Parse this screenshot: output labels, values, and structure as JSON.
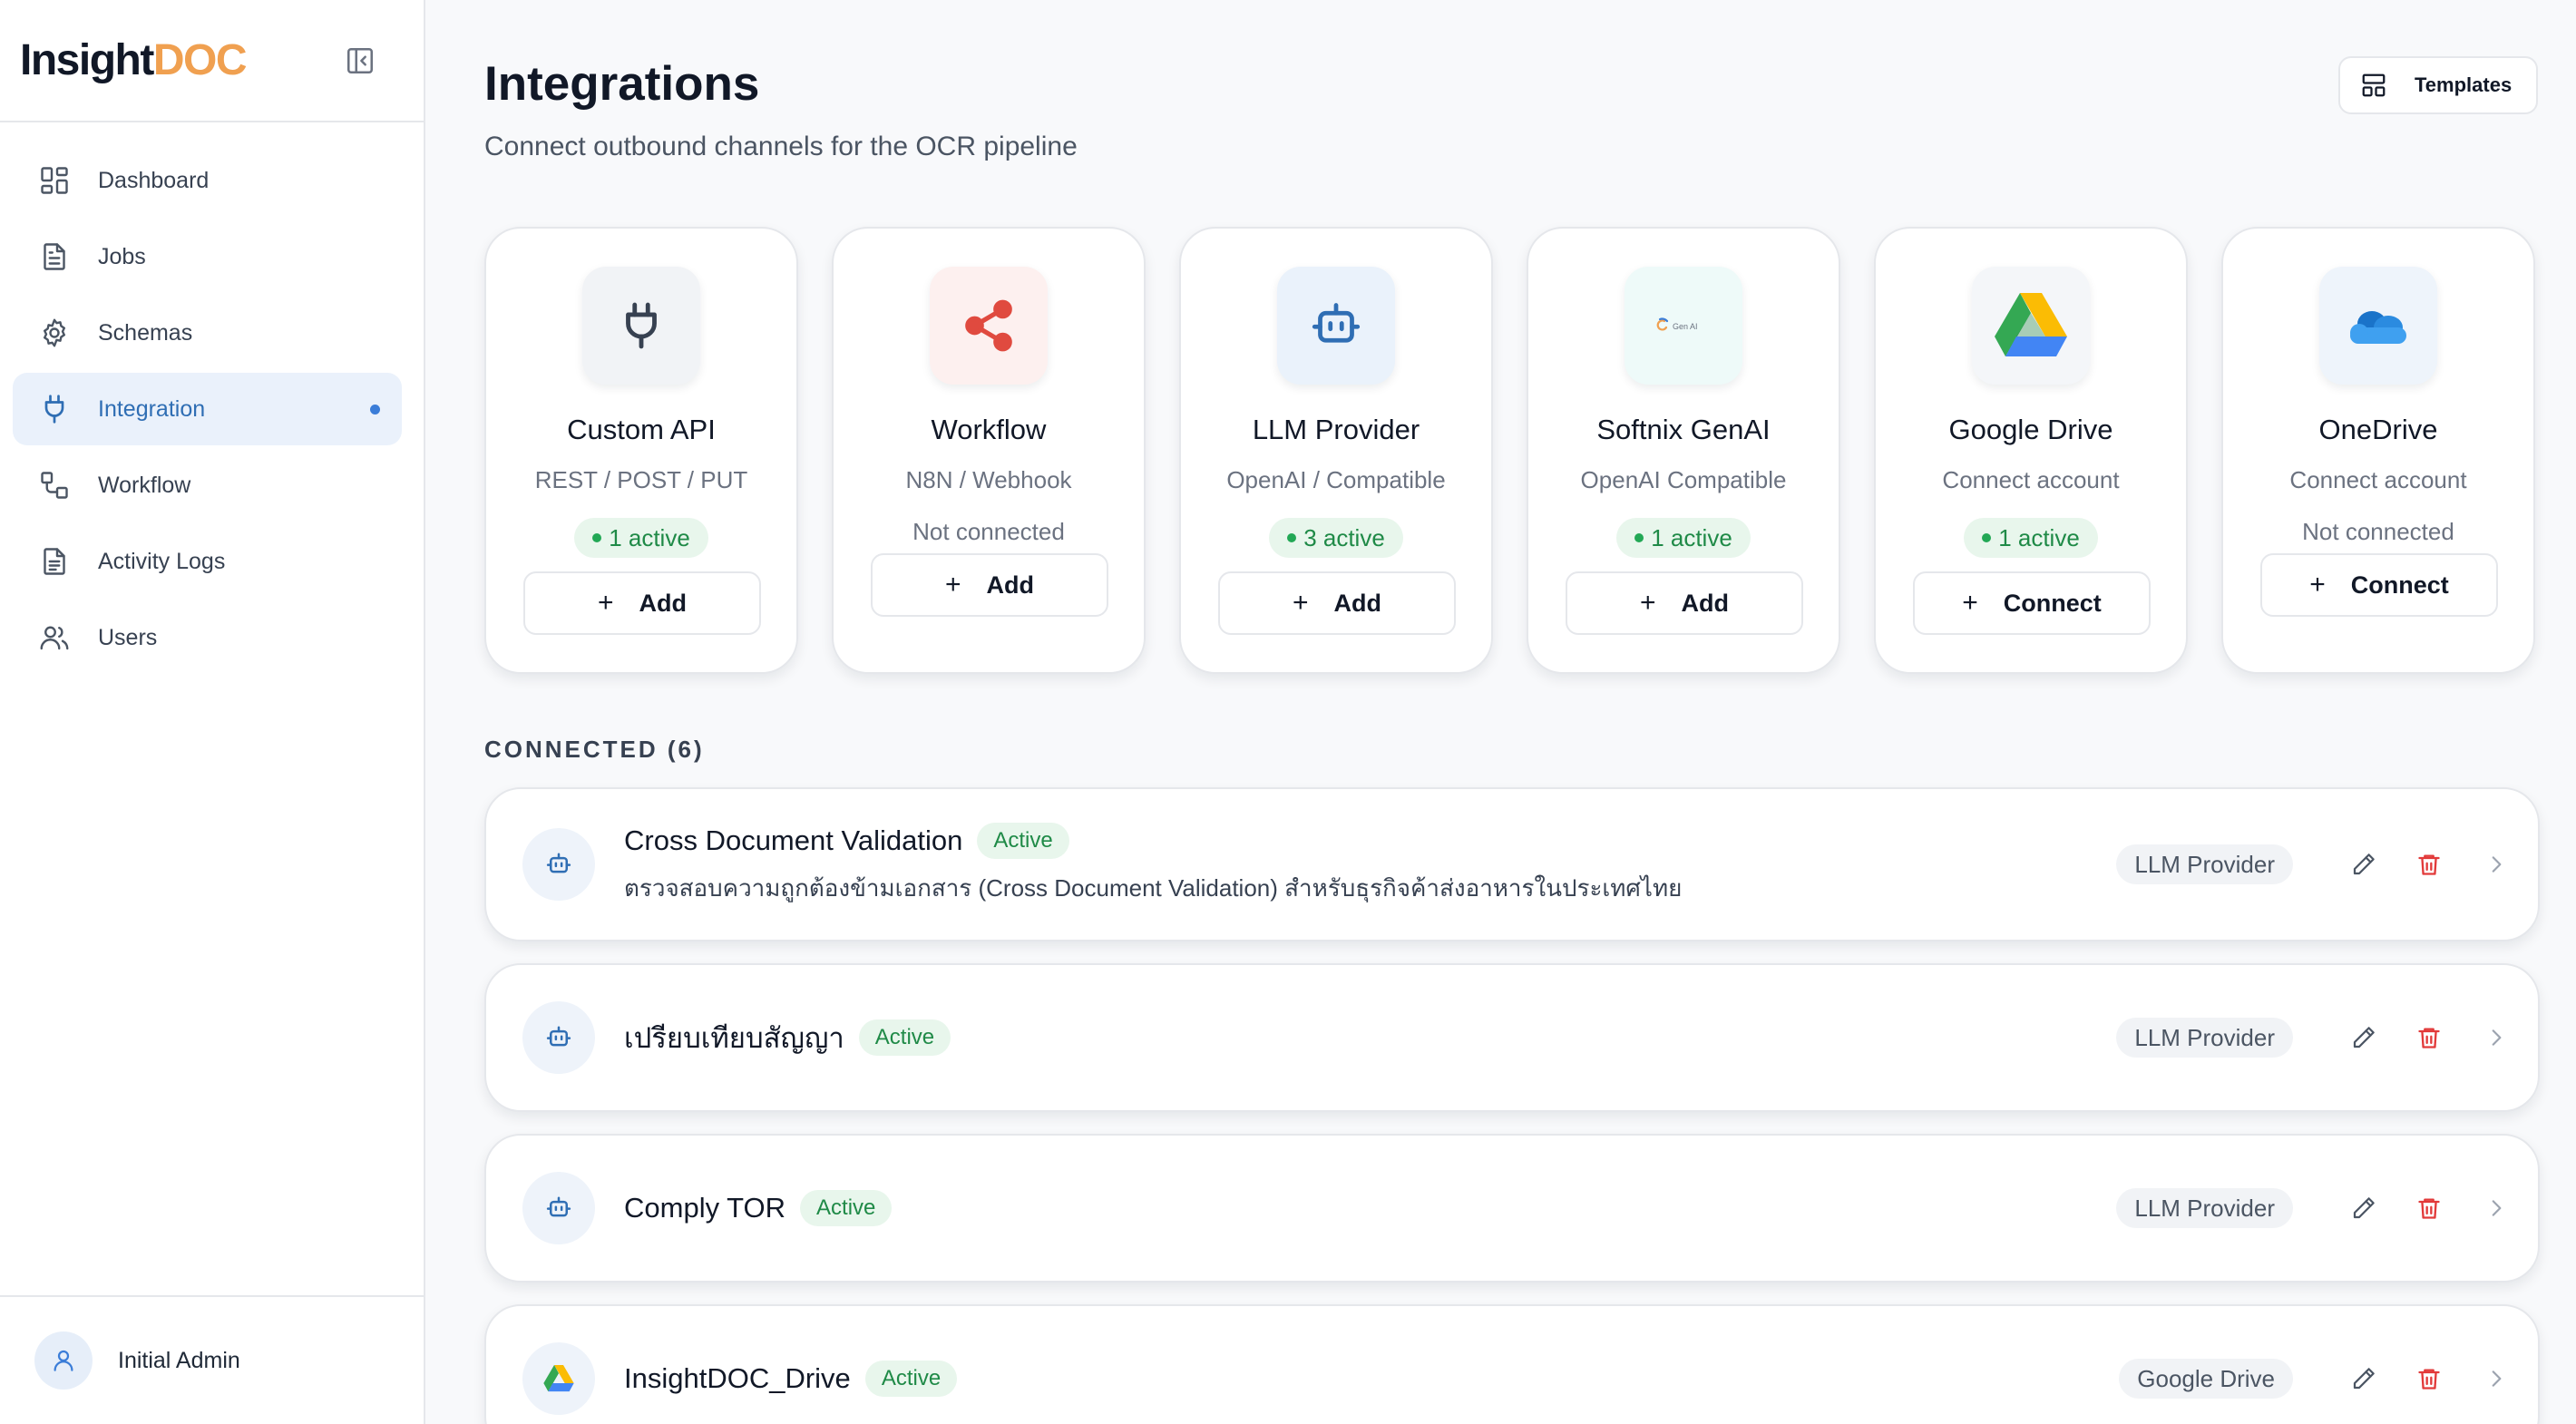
{
  "brand": {
    "logo_part1": "Insight",
    "logo_part2": "DOC"
  },
  "sidebar": {
    "items": [
      {
        "label": "Dashboard",
        "icon": "dashboard-icon"
      },
      {
        "label": "Jobs",
        "icon": "document-icon"
      },
      {
        "label": "Schemas",
        "icon": "gear-icon"
      },
      {
        "label": "Integration",
        "icon": "plug-icon",
        "active": true
      },
      {
        "label": "Workflow",
        "icon": "workflow-icon"
      },
      {
        "label": "Activity Logs",
        "icon": "log-icon"
      },
      {
        "label": "Users",
        "icon": "users-icon"
      }
    ],
    "user": {
      "name": "Initial Admin"
    }
  },
  "header": {
    "title": "Integrations",
    "subtitle": "Connect outbound channels for the OCR pipeline",
    "templates_label": "Templates"
  },
  "cards": [
    {
      "title": "Custom API",
      "subtitle": "REST / POST / PUT",
      "status": "1 active",
      "button": "Add"
    },
    {
      "title": "Workflow",
      "subtitle": "N8N / Webhook",
      "status": "Not connected",
      "button": "Add"
    },
    {
      "title": "LLM Provider",
      "subtitle": "OpenAI / Compatible",
      "status": "3 active",
      "button": "Add"
    },
    {
      "title": "Softnix GenAI",
      "subtitle": "OpenAI Compatible",
      "status": "1 active",
      "button": "Add",
      "logo_text": "Gen AI"
    },
    {
      "title": "Google Drive",
      "subtitle": "Connect account",
      "status": "1 active",
      "button": "Connect"
    },
    {
      "title": "OneDrive",
      "subtitle": "Connect account",
      "status": "Not connected",
      "button": "Connect"
    }
  ],
  "connected": {
    "label": "CONNECTED (6)",
    "rows": [
      {
        "title": "Cross Document Validation",
        "badge": "Active",
        "description": "ตรวจสอบความถูกต้องข้ามเอกสาร (Cross Document Validation) สำหรับธุรกิจค้าส่งอาหารในประเทศไทย",
        "tag": "LLM Provider",
        "icon": "robot-icon"
      },
      {
        "title": "เปรียบเทียบสัญญา",
        "badge": "Active",
        "tag": "LLM Provider",
        "icon": "robot-icon"
      },
      {
        "title": "Comply TOR",
        "badge": "Active",
        "tag": "LLM Provider",
        "icon": "robot-icon"
      },
      {
        "title": "InsightDOC_Drive",
        "badge": "Active",
        "tag": "Google Drive",
        "icon": "google-drive-icon"
      }
    ]
  },
  "colors": {
    "accent": "#2f6eb4",
    "logo_orange": "#f0a050",
    "active_green": "#1f8a47",
    "delete_red": "#e23a3a"
  }
}
